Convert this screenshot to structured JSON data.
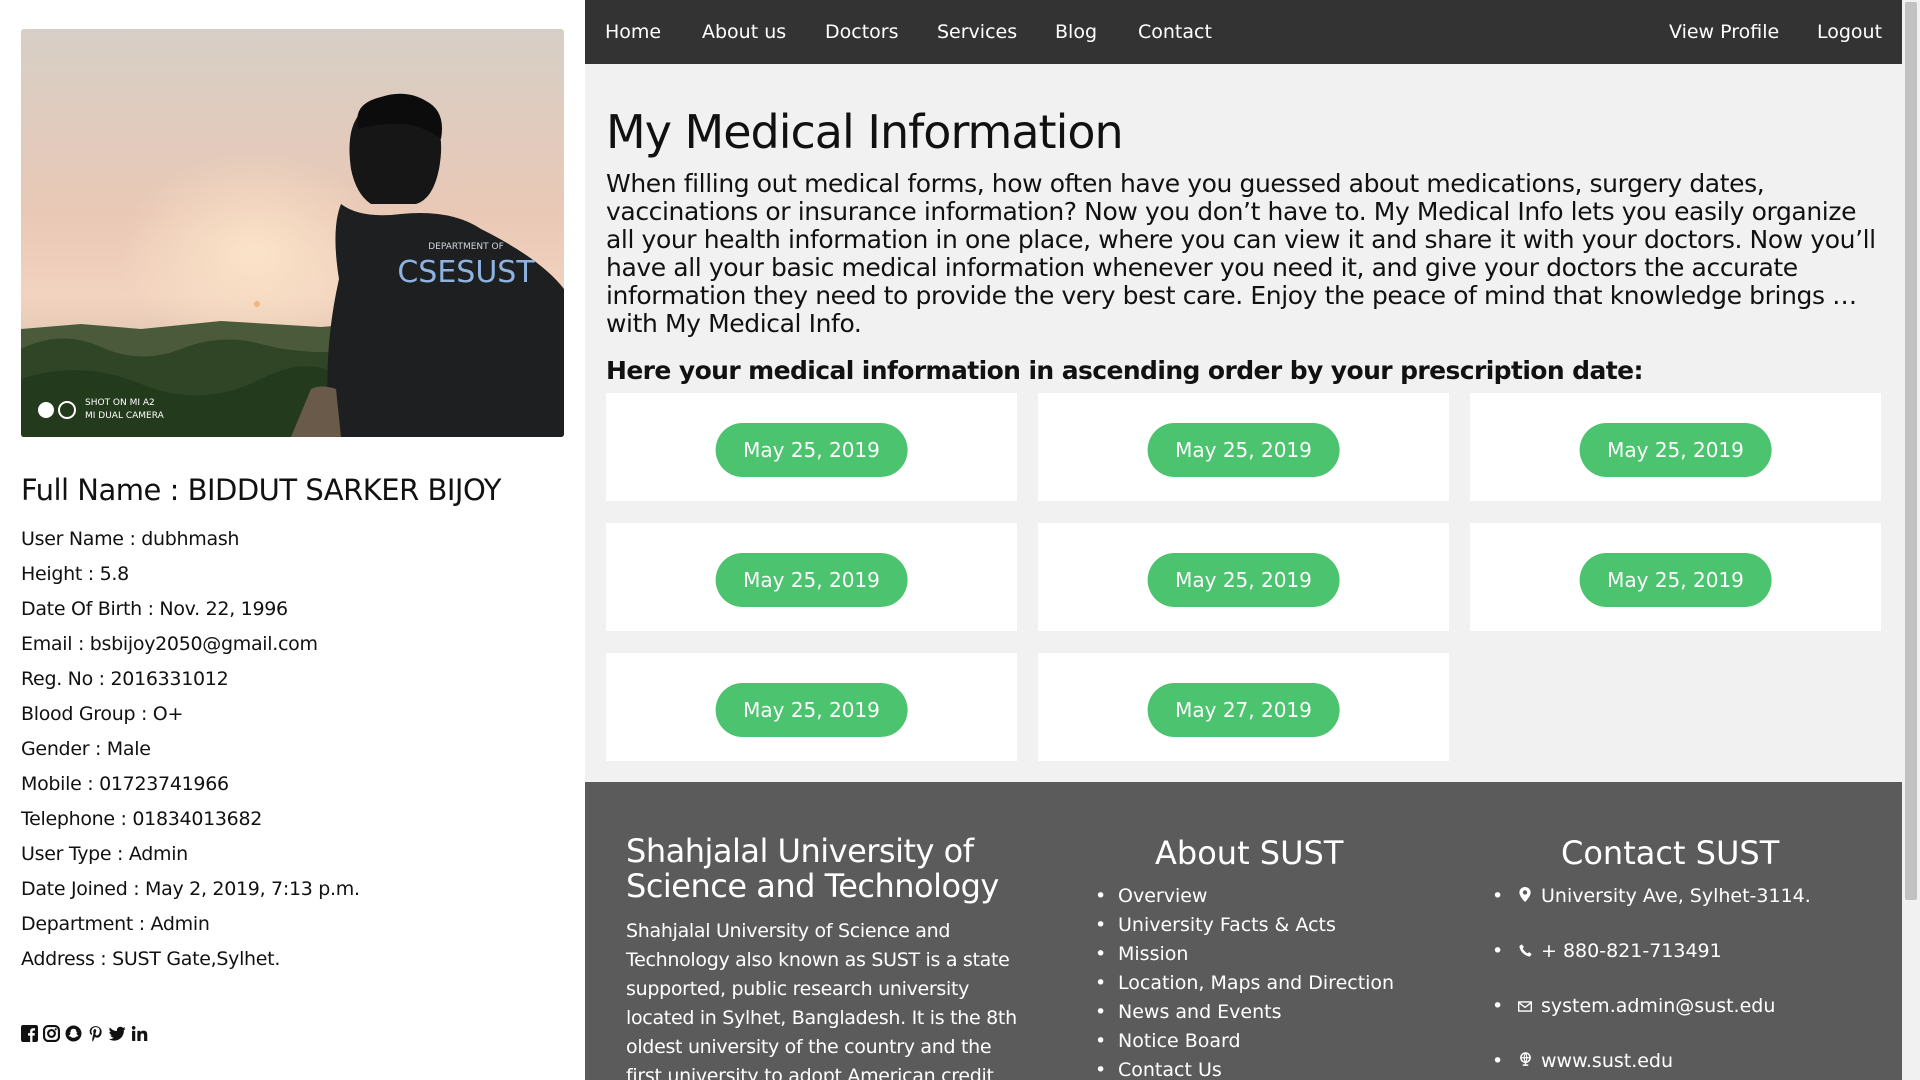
{
  "nav": {
    "items": [
      "Home",
      "About us",
      "Doctors",
      "Services",
      "Blog",
      "Contact"
    ],
    "right": [
      "View Profile",
      "Logout"
    ]
  },
  "profile": {
    "photo": {
      "shirt_text_top": "DEPARTMENT OF",
      "shirt_text": "CSESUST",
      "watermark_line1": "SHOT ON MI A2",
      "watermark_line2": "MI DUAL CAMERA"
    },
    "full_name": "Full Name : BIDDUT SARKER BIJOY",
    "fields": [
      "User Name : dubhmash",
      "Height : 5.8",
      "Date Of Birth : Nov. 22, 1996",
      "Email : bsbijoy2050@gmail.com",
      "Reg. No : 2016331012",
      "Blood Group : O+",
      "Gender : Male",
      "Mobile : 01723741966",
      "Telephone : 01834013682",
      "User Type : Admin",
      "Date Joined : May 2, 2019, 7:13 p.m.",
      "Department : Admin",
      "Address : SUST Gate,Sylhet."
    ],
    "social_icons": [
      "facebook-icon",
      "instagram-icon",
      "snapchat-icon",
      "pinterest-icon",
      "twitter-icon",
      "linkedin-icon"
    ]
  },
  "main": {
    "title": "My Medical Information",
    "intro": "When filling out medical forms, how often have you guessed about medications, surgery dates, vaccinations or insurance information? Now you don’t have to. My Medical Info lets you easily organize all your health information in one place, where you can view it and share it with your doctors. Now you’ll have all your basic medical information whenever you need it, and give your doctors the accurate information they need to provide the very best care. Enjoy the peace of mind that knowledge brings … with My Medical Info.",
    "subheading": "Here your medical information in ascending order by your prescription date:",
    "prescriptions": [
      "May 25, 2019",
      "May 25, 2019",
      "May 25, 2019",
      "May 25, 2019",
      "May 25, 2019",
      "May 25, 2019",
      "May 25, 2019",
      "May 27, 2019"
    ]
  },
  "footer": {
    "about_title": "Shahjalal University of Science and Technology",
    "about_text": "Shahjalal University of Science and Technology also known as SUST is a state supported, public research university located in Sylhet, Bangladesh. It is the 8th oldest university of the country and the first university to adopt American credit system.",
    "links_title": "About SUST",
    "links": [
      "Overview",
      "University Facts & Acts",
      "Mission",
      "Location, Maps and Direction",
      "News and Events",
      "Notice Board",
      "Contact Us"
    ],
    "contact_title": "Contact SUST",
    "contact": [
      {
        "icon": "location-pin-icon",
        "text": "University Ave, Sylhet-3114."
      },
      {
        "icon": "phone-icon",
        "text": "+ 880-821-713491"
      },
      {
        "icon": "envelope-icon",
        "text": "system.admin@sust.edu"
      },
      {
        "icon": "globe-icon",
        "text": "www.sust.edu"
      }
    ]
  },
  "colors": {
    "nav_bg": "#333333",
    "accent_green": "#4cc36e",
    "footer_bg": "#5b5b5b",
    "main_bg": "#f1f1f1"
  }
}
